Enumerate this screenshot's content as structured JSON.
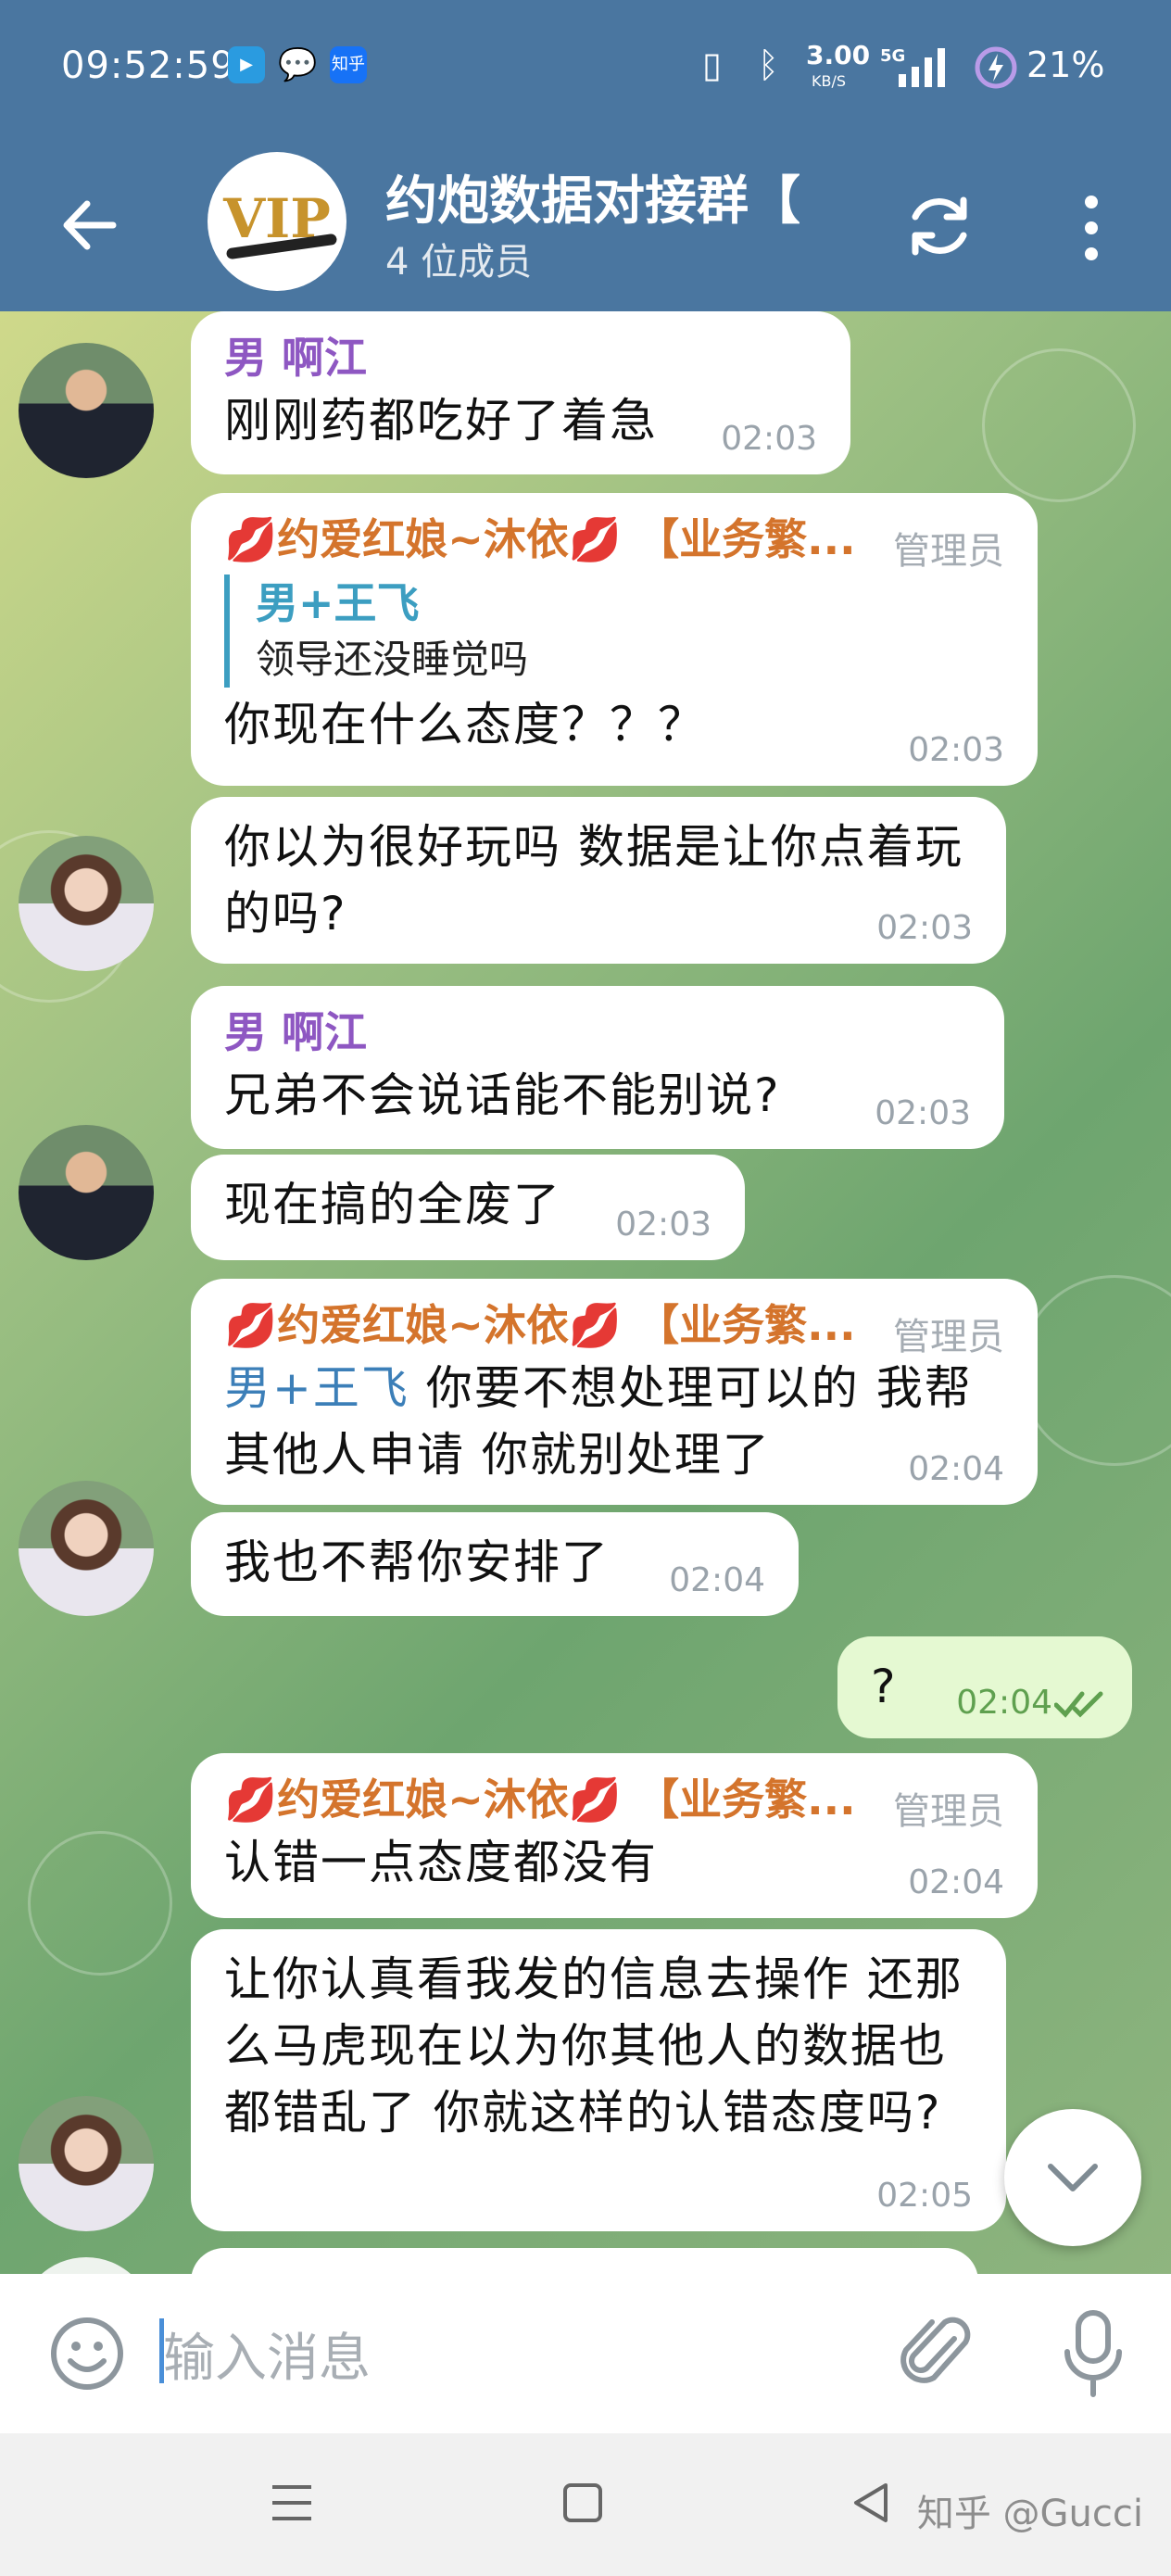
{
  "status_bar": {
    "time": "09:52:59",
    "app_icons": [
      "video-app-icon",
      "wechat-icon",
      "zhihu-icon"
    ],
    "zhihu_label": "知乎",
    "network_speed": "3.00",
    "network_unit": "KB/S",
    "signal_label": "5G",
    "battery": "21%"
  },
  "header": {
    "title": "约炮数据对接群【",
    "member_count": "4 位成员",
    "avatar_text": "VIP"
  },
  "messages": [
    {
      "sender": "男 啊江",
      "text": "刚刚药都吃好了着急",
      "time": "02:03"
    },
    {
      "sender": "约爱红娘~沐依",
      "sender_suffix": "【业务繁...",
      "badge": "管理员",
      "quote_name": "男+王飞",
      "quote_text": "领导还没睡觉吗",
      "text": "你现在什么态度？？？",
      "time": "02:03"
    },
    {
      "text": "你以为很好玩吗 数据是让你点着玩的吗?",
      "time": "02:03"
    },
    {
      "sender": "男 啊江",
      "text": "兄弟不会说话能不能别说?",
      "time": "02:03"
    },
    {
      "text": "现在搞的全废了",
      "time": "02:03"
    },
    {
      "sender": "约爱红娘~沐依",
      "sender_suffix": "【业务繁...",
      "badge": "管理员",
      "mention": "男+王飞",
      "text": " 你要不想处理可以的 我帮其他人申请 你就别处理了",
      "time": "02:04"
    },
    {
      "text": "我也不帮你安排了",
      "time": "02:04"
    },
    {
      "text": "?",
      "time": "02:04",
      "outgoing": true
    },
    {
      "sender": "约爱红娘~沐依",
      "sender_suffix": "【业务繁...",
      "badge": "管理员",
      "text": "认错一点态度都没有",
      "time": "02:04"
    },
    {
      "text": "让你认真看我发的信息去操作 还那么马虎现在以为你其他人的数据也都错乱了 你就这样的认错态度吗?",
      "time": "02:05"
    }
  ],
  "input": {
    "placeholder": "输入消息"
  },
  "watermark": "知乎 @Gucci",
  "colors": {
    "header": "#4a76a0",
    "accent": "#3c9ec1",
    "outgoing_bubble": "#e5f9d2"
  }
}
